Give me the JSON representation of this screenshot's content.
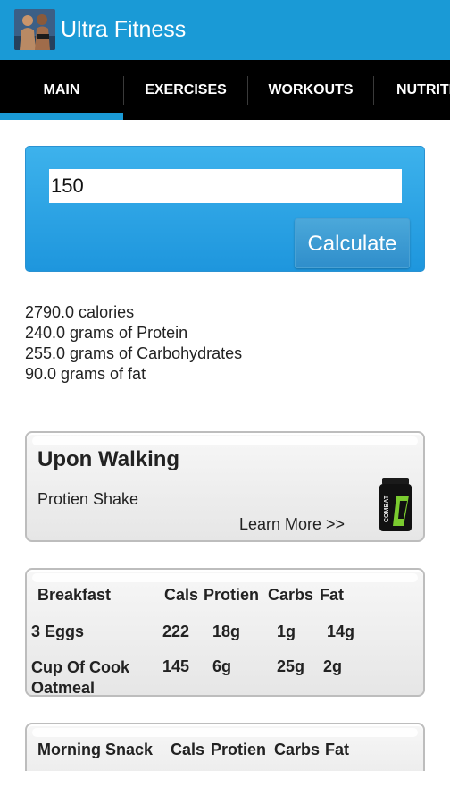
{
  "app": {
    "title": "Ultra Fitness"
  },
  "tabs": [
    {
      "label": "MAIN"
    },
    {
      "label": "EXERCISES"
    },
    {
      "label": "WORKOUTS"
    },
    {
      "label": "NUTRITION"
    }
  ],
  "calculator": {
    "weight_value": "150",
    "button_label": "Calculate"
  },
  "results": {
    "calories": "2790.0 calories",
    "protein": "240.0 grams of Protein",
    "carbs": "255.0 grams of Carbohydrates",
    "fat": "90.0 grams of fat"
  },
  "promo": {
    "title": "Upon Walking",
    "item": "Protien Shake",
    "link": "Learn More >>",
    "product_label": "COMBAT"
  },
  "breakfast": {
    "header": {
      "meal": "Breakfast",
      "cals": "Cals",
      "protein": "Protien",
      "carbs": "Carbs",
      "fat": "Fat"
    },
    "rows": [
      {
        "name": "3 Eggs",
        "cals": "222",
        "protein": "18g",
        "carbs": "1g",
        "fat": "14g"
      },
      {
        "name": "Cup Of Cook Oatmeal",
        "cals": "145",
        "protein": "6g",
        "carbs": "25g",
        "fat": "2g"
      }
    ]
  },
  "morning_snack": {
    "header": {
      "meal": "Morning Snack",
      "cals": "Cals",
      "protein": "Protien",
      "carbs": "Carbs",
      "fat": "Fat"
    }
  }
}
